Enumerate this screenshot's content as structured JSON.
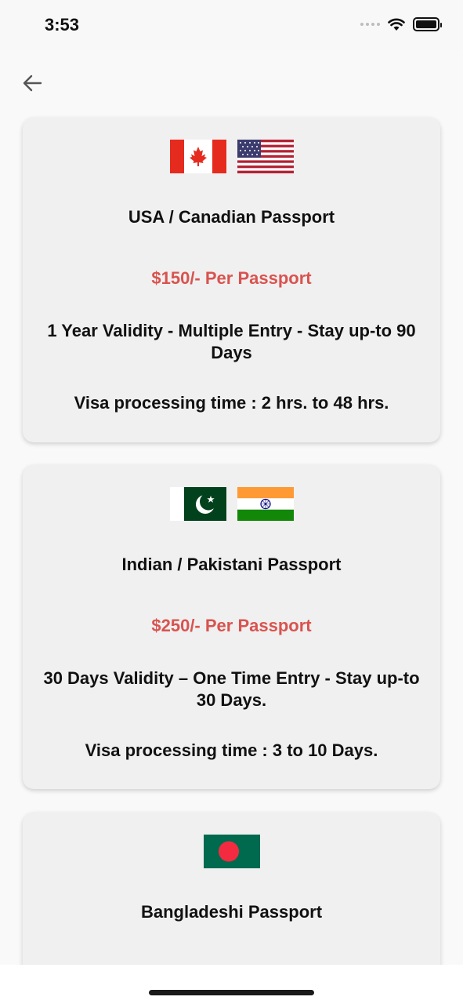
{
  "status_bar": {
    "time": "3:53"
  },
  "header": {
    "back_icon": "arrow-left-icon"
  },
  "cards": [
    {
      "flags": [
        "canada-flag-icon",
        "usa-flag-icon"
      ],
      "title": "USA / Canadian Passport",
      "price": "$150/- Per Passport",
      "validity": "1 Year Validity - Multiple Entry - Stay up-to 90 Days",
      "processing": "Visa processing time : 2 hrs. to 48 hrs."
    },
    {
      "flags": [
        "pakistan-flag-icon",
        "india-flag-icon"
      ],
      "title": "Indian / Pakistani Passport",
      "price": "$250/- Per Passport",
      "validity": "30 Days Validity – One Time Entry - Stay up-to 30 Days.",
      "processing": "Visa processing time : 3 to 10 Days."
    },
    {
      "flags": [
        "bangladesh-flag-icon"
      ],
      "title": "Bangladeshi Passport"
    }
  ],
  "colors": {
    "price": "#d9534f",
    "card_bg": "#f0f0f0",
    "page_bg": "#f9f9f9"
  }
}
